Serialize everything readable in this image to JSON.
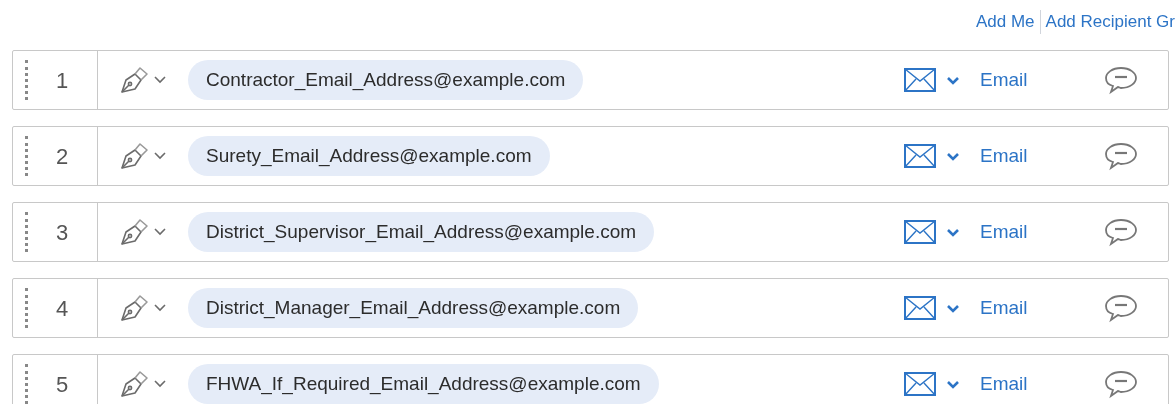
{
  "header_links": [
    "Add Me",
    "Add Recipient Gr"
  ],
  "recipients": [
    {
      "order": "1",
      "email": "Contractor_Email_Address@example.com",
      "delivery": "Email"
    },
    {
      "order": "2",
      "email": "Surety_Email_Address@example.com",
      "delivery": "Email"
    },
    {
      "order": "3",
      "email": "District_Supervisor_Email_Address@example.com",
      "delivery": "Email"
    },
    {
      "order": "4",
      "email": "District_Manager_Email_Address@example.com",
      "delivery": "Email"
    },
    {
      "order": "5",
      "email": "FHWA_If_Required_Email_Address@example.com",
      "delivery": "Email"
    }
  ]
}
